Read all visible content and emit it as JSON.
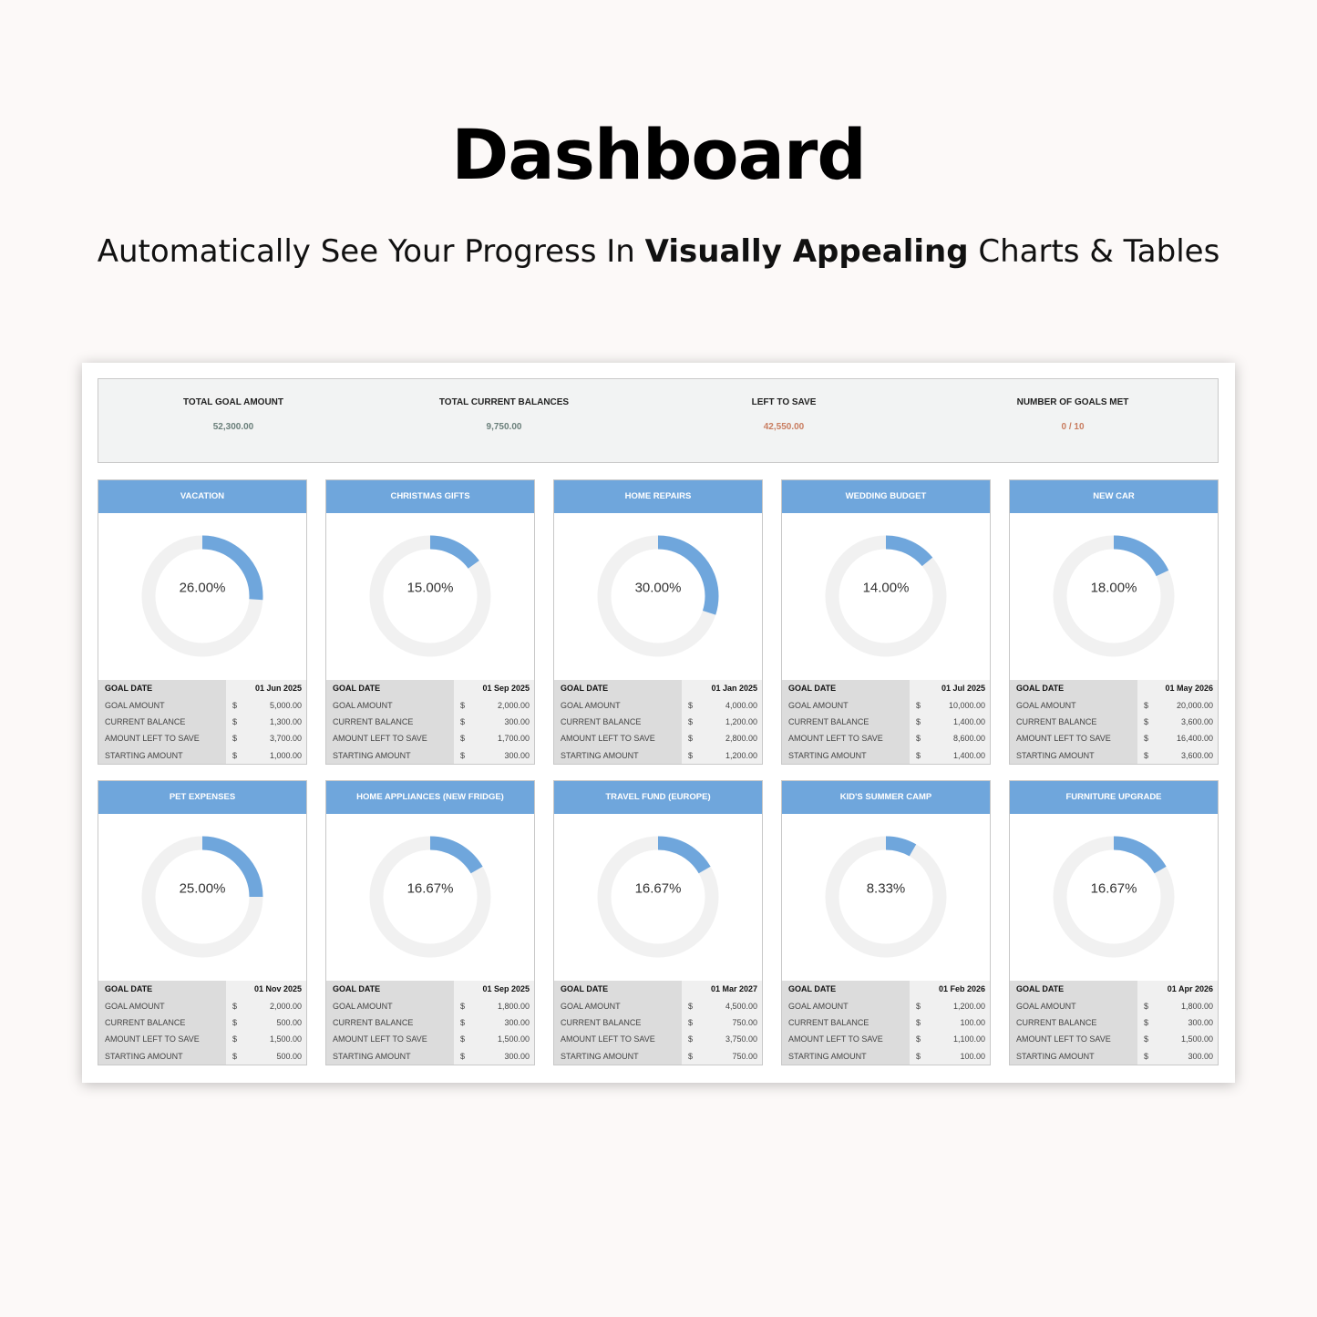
{
  "header": {
    "title": "Dashboard",
    "subtitle_pre": "Automatically See Your Progress In ",
    "subtitle_bold": "Visually Appealing",
    "subtitle_post": " Charts & Tables"
  },
  "colors": {
    "accent": "#6fa6dc",
    "track": "#f1f1f1",
    "value_neutral": "#6a7f7a",
    "value_warn": "#c97d60"
  },
  "summary": [
    {
      "label": "TOTAL GOAL AMOUNT",
      "value": "52,300.00",
      "color": "#6a7f7a"
    },
    {
      "label": "TOTAL CURRENT BALANCES",
      "value": "9,750.00",
      "color": "#6a7f7a"
    },
    {
      "label": "LEFT TO SAVE",
      "value": "42,550.00",
      "color": "#c97d60"
    },
    {
      "label": "NUMBER OF GOALS MET",
      "value": "0 / 10",
      "color": "#c97d60"
    }
  ],
  "row_labels": {
    "goal_date": "GOAL DATE",
    "goal_amount": "GOAL AMOUNT",
    "current_balance": "CURRENT BALANCE",
    "left": "AMOUNT LEFT TO SAVE",
    "starting": "STARTING AMOUNT",
    "currency": "$"
  },
  "goals": [
    {
      "name": "VACATION",
      "progress": 26,
      "progress_label": "26.00%",
      "goal_date": "01 Jun 2025",
      "goal_amount": "5,000.00",
      "current_balance": "1,300.00",
      "left": "3,700.00",
      "starting": "1,000.00"
    },
    {
      "name": "CHRISTMAS GIFTS",
      "progress": 15,
      "progress_label": "15.00%",
      "goal_date": "01 Sep 2025",
      "goal_amount": "2,000.00",
      "current_balance": "300.00",
      "left": "1,700.00",
      "starting": "300.00"
    },
    {
      "name": "HOME REPAIRS",
      "progress": 30,
      "progress_label": "30.00%",
      "goal_date": "01 Jan 2025",
      "goal_amount": "4,000.00",
      "current_balance": "1,200.00",
      "left": "2,800.00",
      "starting": "1,200.00"
    },
    {
      "name": "WEDDING BUDGET",
      "progress": 14,
      "progress_label": "14.00%",
      "goal_date": "01 Jul 2025",
      "goal_amount": "10,000.00",
      "current_balance": "1,400.00",
      "left": "8,600.00",
      "starting": "1,400.00"
    },
    {
      "name": "NEW CAR",
      "progress": 18,
      "progress_label": "18.00%",
      "goal_date": "01 May 2026",
      "goal_amount": "20,000.00",
      "current_balance": "3,600.00",
      "left": "16,400.00",
      "starting": "3,600.00"
    },
    {
      "name": "PET EXPENSES",
      "progress": 25,
      "progress_label": "25.00%",
      "goal_date": "01 Nov 2025",
      "goal_amount": "2,000.00",
      "current_balance": "500.00",
      "left": "1,500.00",
      "starting": "500.00"
    },
    {
      "name": "HOME APPLIANCES (NEW FRIDGE)",
      "progress": 16.67,
      "progress_label": "16.67%",
      "goal_date": "01 Sep 2025",
      "goal_amount": "1,800.00",
      "current_balance": "300.00",
      "left": "1,500.00",
      "starting": "300.00"
    },
    {
      "name": "TRAVEL FUND (EUROPE)",
      "progress": 16.67,
      "progress_label": "16.67%",
      "goal_date": "01 Mar 2027",
      "goal_amount": "4,500.00",
      "current_balance": "750.00",
      "left": "3,750.00",
      "starting": "750.00"
    },
    {
      "name": "KID'S SUMMER CAMP",
      "progress": 8.33,
      "progress_label": "8.33%",
      "goal_date": "01 Feb 2026",
      "goal_amount": "1,200.00",
      "current_balance": "100.00",
      "left": "1,100.00",
      "starting": "100.00"
    },
    {
      "name": "FURNITURE UPGRADE",
      "progress": 16.67,
      "progress_label": "16.67%",
      "goal_date": "01 Apr 2026",
      "goal_amount": "1,800.00",
      "current_balance": "300.00",
      "left": "1,500.00",
      "starting": "300.00"
    }
  ]
}
